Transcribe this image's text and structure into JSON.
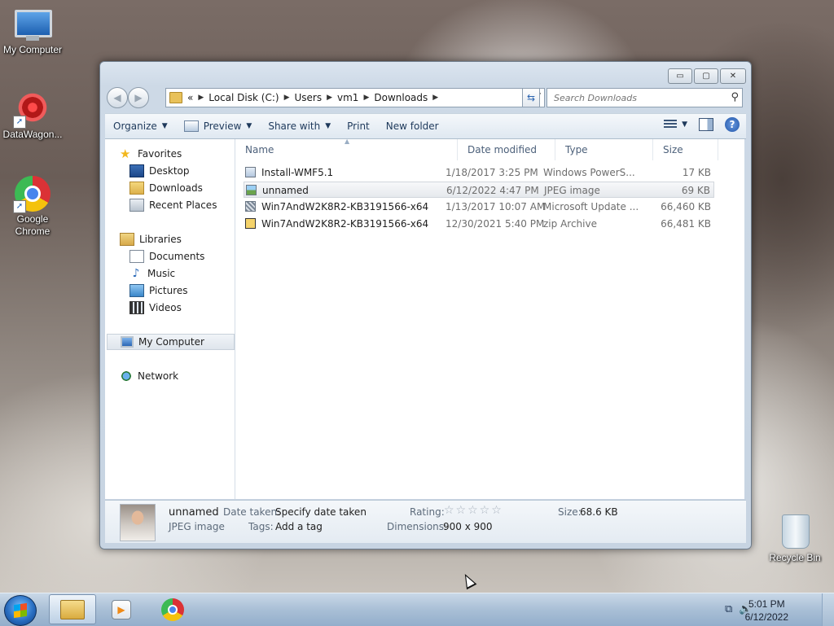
{
  "desktop": {
    "icons": [
      {
        "label": "My Computer"
      },
      {
        "label": "DataWagon..."
      },
      {
        "label": "Google Chrome"
      },
      {
        "label": "Recycle Bin"
      }
    ]
  },
  "window": {
    "controls": {
      "minimize": "▭",
      "maximize": "▢",
      "close": "✕"
    },
    "address": {
      "prefix": "«",
      "crumbs": [
        "Local Disk (C:)",
        "Users",
        "vm1",
        "Downloads"
      ]
    },
    "search": {
      "placeholder": "Search Downloads"
    },
    "toolbar": {
      "organize": "Organize",
      "preview": "Preview",
      "share_with": "Share with",
      "print": "Print",
      "new_folder": "New folder"
    },
    "nav": {
      "favorites": "Favorites",
      "desktop": "Desktop",
      "downloads": "Downloads",
      "recent_places": "Recent Places",
      "libraries": "Libraries",
      "documents": "Documents",
      "music": "Music",
      "pictures": "Pictures",
      "videos": "Videos",
      "my_computer": "My Computer",
      "network": "Network"
    },
    "columns": {
      "name": "Name",
      "date": "Date modified",
      "type": "Type",
      "size": "Size"
    },
    "files": [
      {
        "name": "Install-WMF5.1",
        "date": "1/18/2017 3:25 PM",
        "type": "Windows PowerS...",
        "size": "17 KB",
        "icon": "powershell-icon"
      },
      {
        "name": "unnamed",
        "date": "6/12/2022 4:47 PM",
        "type": "JPEG image",
        "size": "69 KB",
        "icon": "image-icon"
      },
      {
        "name": "Win7AndW2K8R2-KB3191566-x64",
        "date": "1/13/2017 10:07 AM",
        "type": "Microsoft Update ...",
        "size": "66,460 KB",
        "icon": "update-icon"
      },
      {
        "name": "Win7AndW2K8R2-KB3191566-x64",
        "date": "12/30/2021 5:40 PM",
        "type": "zip Archive",
        "size": "66,481 KB",
        "icon": "zip-icon"
      }
    ],
    "details": {
      "name": "unnamed",
      "type": "JPEG image",
      "date_taken_label": "Date taken:",
      "date_taken_value": "Specify date taken",
      "tags_label": "Tags:",
      "tags_value": "Add a tag",
      "rating_label": "Rating:",
      "rating_stars": "☆☆☆☆☆",
      "dimensions_label": "Dimensions:",
      "dimensions_value": "900 x 900",
      "size_label": "Size:",
      "size_value": "68.6 KB"
    }
  },
  "taskbar": {
    "clock_time": "5:01 PM",
    "clock_date": "6/12/2022"
  }
}
